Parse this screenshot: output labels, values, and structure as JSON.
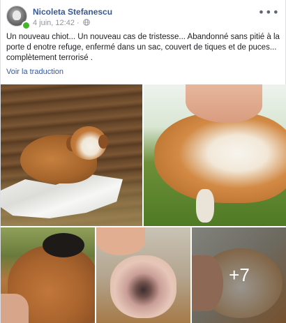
{
  "post": {
    "author": "Nicoleta Stefanescu",
    "timestamp": "4 juin, 12:42",
    "separator": "·",
    "privacy_icon": "globe-icon",
    "more_label": "•••",
    "text": "Un nouveau chiot... Un nouveau cas de tristesse... Abandonné sans pitié à la porte d enotre refuge, enfermé dans un sac, couvert de tiques et de puces... complètement terrorisé .",
    "translate_label": "Voir la traduction",
    "more_photos": "+7"
  },
  "colors": {
    "link": "#385898",
    "online": "#42b72a",
    "meta": "#90949c"
  }
}
